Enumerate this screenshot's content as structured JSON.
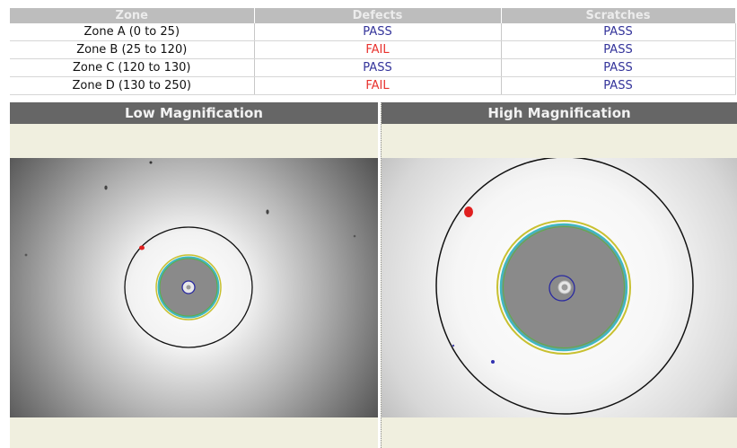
{
  "table": {
    "headers": {
      "zone": "Zone",
      "defects": "Defects",
      "scratches": "Scratches"
    },
    "rows": [
      {
        "zone": "Zone A (0 to 25)",
        "defects": "PASS",
        "scratches": "PASS"
      },
      {
        "zone": "Zone B (25 to 120)",
        "defects": "FAIL",
        "scratches": "PASS"
      },
      {
        "zone": "Zone C (120 to 130)",
        "defects": "PASS",
        "scratches": "PASS"
      },
      {
        "zone": "Zone D (130 to 250)",
        "defects": "FAIL",
        "scratches": "PASS"
      }
    ]
  },
  "panels": {
    "low": {
      "title": "Low Magnification"
    },
    "high": {
      "title": "High Magnification"
    }
  },
  "colors": {
    "pass": "#33339a",
    "fail": "#e8322e",
    "header_bg": "#666666",
    "panel_bg": "#f0efdf"
  }
}
